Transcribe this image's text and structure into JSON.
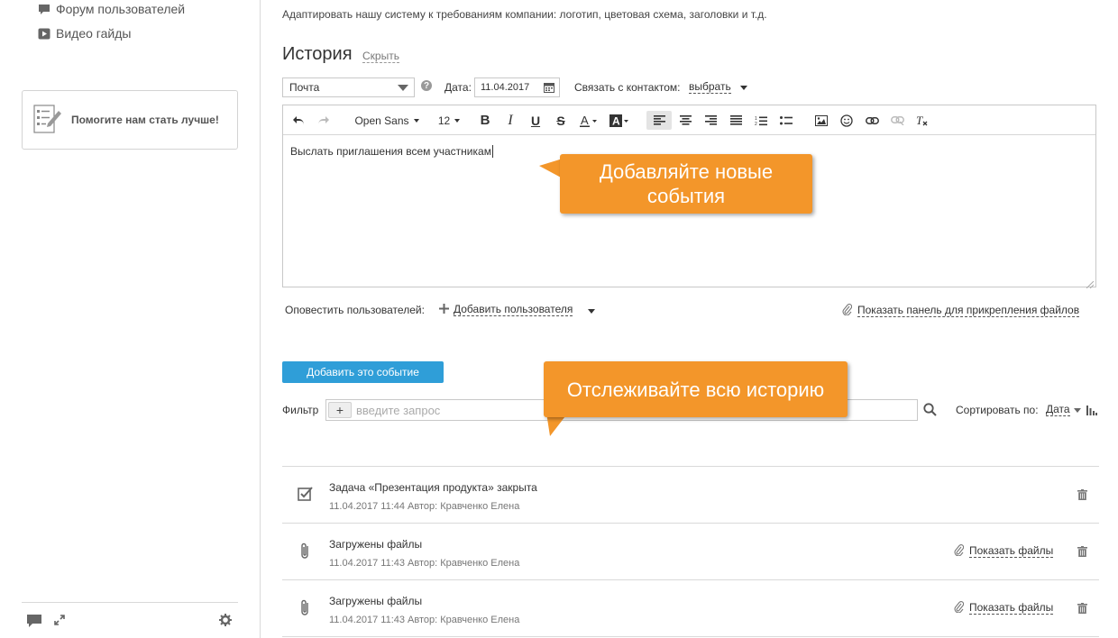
{
  "sidebar": {
    "items": [
      {
        "label": "Форум пользователей",
        "icon": "chat-bubble-icon"
      },
      {
        "label": "Видео гайды",
        "icon": "play-video-icon"
      }
    ],
    "help_label": "Помогите нам стать лучше!"
  },
  "main": {
    "hint_text": "Адаптировать нашу систему к требованиям компании: логотип, цветовая схема, заголовки и т.д.",
    "history_title": "История",
    "hide_label": "Скрыть",
    "type_select": "Почта",
    "date_label": "Дата:",
    "date_value": "11.04.2017",
    "contact_label": "Связать с контактом:",
    "contact_link": "выбрать",
    "toolbar": {
      "font": "Open Sans",
      "size": "12"
    },
    "editor_text": "Выслать приглашения всем участникам",
    "notify_label": "Оповестить пользователей:",
    "add_user_label": "Добавить пользователя",
    "attach_label": "Показать панель для прикрепления файлов",
    "add_event_button": "Добавить это событие",
    "filter_label": "Фильтр",
    "filter_placeholder": "введите запрос",
    "sort_label": "Сортировать по:",
    "sort_value": "Дата"
  },
  "history": [
    {
      "icon": "task-check-icon",
      "title": "Задача «Презентация продукта» закрыта",
      "meta": "11.04.2017 11:44 Автор: Кравченко Елена"
    },
    {
      "icon": "paperclip-icon",
      "title": "Загружены файлы",
      "meta": "11.04.2017 11:43 Автор: Кравченко Елена",
      "action": "Показать файлы"
    },
    {
      "icon": "paperclip-icon",
      "title": "Загружены файлы",
      "meta": "11.04.2017 11:43 Автор: Кравченко Елена",
      "action": "Показать файлы"
    }
  ],
  "callouts": {
    "first": "Добавляйте новые события",
    "second": "Отслеживайте всю историю"
  },
  "colors": {
    "accent": "#2f9ed8",
    "callout": "#f3962a"
  }
}
